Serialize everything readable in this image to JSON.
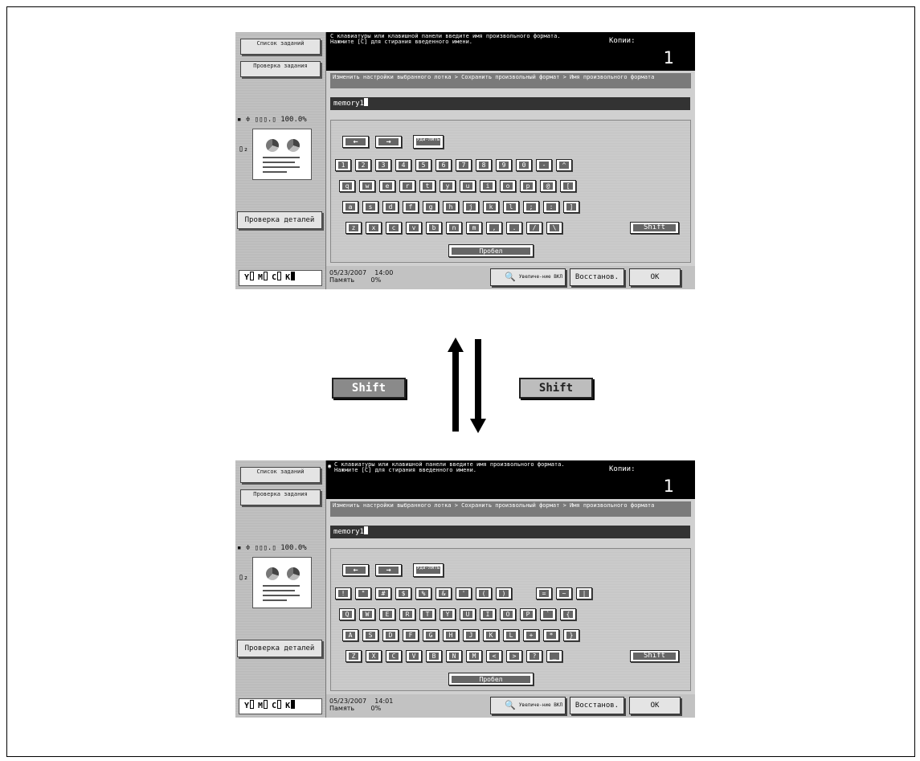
{
  "jobs_list_label": "Список заданий",
  "check_job_label": "Проверка задания",
  "zoom_readout": "100.0%",
  "detail_label": "Проверка деталей",
  "toner": [
    "Y",
    "M",
    "C",
    "K"
  ],
  "message": "С клавиатуры или клавишной панели введите имя произвольного формата. Нажмите [C] для стирания введенного имени.",
  "copies_label": "Копии:",
  "copies_value": "1",
  "breadcrumb": "Изменить настройки выбранного лотка > Сохранить произвольный формат > Имя произвольного формата",
  "entry_value": "memory1",
  "delete_label": "Уда-лить",
  "space_label": "Пробел",
  "shift_label": "Shift",
  "zoom_button_label": "Увеличе-ние ВКЛ",
  "reset_label": "Восстанов.",
  "ok_label": "OK",
  "memory_label": "Память",
  "memory_value": "0%",
  "keyboard_lower": {
    "row1": [
      "1",
      "2",
      "3",
      "4",
      "5",
      "6",
      "7",
      "8",
      "9",
      "0",
      "-",
      "^"
    ],
    "row2": [
      "q",
      "w",
      "e",
      "r",
      "t",
      "y",
      "u",
      "i",
      "o",
      "p",
      "@",
      "["
    ],
    "row3": [
      "a",
      "s",
      "d",
      "f",
      "g",
      "h",
      "j",
      "k",
      "l",
      ";",
      ":",
      "]"
    ],
    "row4": [
      "z",
      "x",
      "c",
      "v",
      "b",
      "n",
      "m",
      ",",
      ".",
      "/",
      "\\"
    ]
  },
  "keyboard_upper": {
    "row1": [
      "!",
      "\"",
      "#",
      "$",
      "%",
      "&",
      "'",
      "(",
      ")",
      "=",
      "~",
      "|"
    ],
    "row2": [
      "Q",
      "W",
      "E",
      "R",
      "T",
      "Y",
      "U",
      "I",
      "O",
      "P",
      "`",
      "{"
    ],
    "row3": [
      "A",
      "S",
      "D",
      "F",
      "G",
      "H",
      "J",
      "K",
      "L",
      "+",
      "*",
      "}"
    ],
    "row4": [
      "Z",
      "X",
      "C",
      "V",
      "B",
      "N",
      "M",
      "<",
      ">",
      "?",
      "_"
    ]
  },
  "screens": [
    {
      "date": "05/23/2007",
      "time": "14:00"
    },
    {
      "date": "05/23/2007",
      "time": "14:01"
    }
  ]
}
